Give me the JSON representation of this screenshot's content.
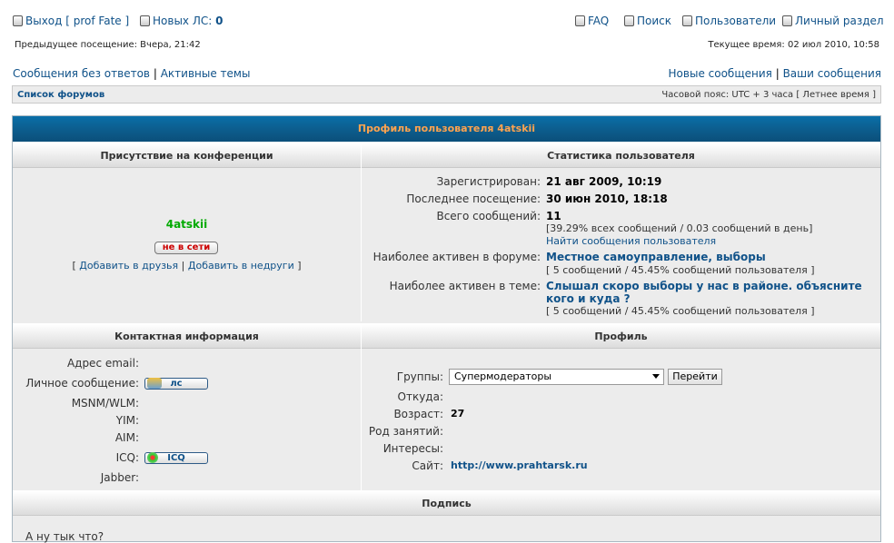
{
  "top": {
    "logout": "Выход [ prof Fate ]",
    "new_pm_label": "Новых ЛС:",
    "new_pm_count": "0",
    "faq": "FAQ",
    "search": "Поиск",
    "users": "Пользователи",
    "ucp": "Личный раздел",
    "last_visit": "Предыдущее посещение: Вчера, 21:42",
    "current_time": "Текущее время: 02 июл 2010, 10:58",
    "unanswered": "Сообщения без ответов",
    "active_topics": "Активные темы",
    "new_posts": "Новые сообщения",
    "your_posts": "Ваши сообщения",
    "sep": "|"
  },
  "navbar": {
    "forum_index": "Список форумов",
    "timezone": "Часовой пояс: UTC + 3 часа [ Летнее время ]"
  },
  "profile": {
    "title": "Профиль пользователя 4atskii",
    "h_presence": "Присутствие на конференции",
    "h_stats": "Статистика пользователя",
    "username": "4atskii",
    "status": "не в сети",
    "friend_open": "[",
    "add_friend": "Добавить в друзья",
    "add_foe": "Добавить в недруги",
    "friend_close": "]",
    "stats": {
      "registered_label": "Зарегистрирован:",
      "registered": "21 авг 2009, 10:19",
      "last_visit_label": "Последнее посещение:",
      "last_visit": "30 июн 2010, 18:18",
      "posts_label": "Всего сообщений:",
      "posts": "11",
      "posts_detail": "[39.29% всех сообщений / 0.03 сообщений в день]",
      "find_posts": "Найти сообщения пользователя",
      "active_forum_label": "Наиболее активен в форуме:",
      "active_forum": "Местное самоуправление, выборы",
      "active_forum_detail": "[ 5 сообщений / 45.45% сообщений пользователя ]",
      "active_topic_label": "Наиболее активен в теме:",
      "active_topic_line1": "Слышал скоро выборы у нас в районе. объясните",
      "active_topic_line2": "кого и куда ?",
      "active_topic_detail": "[ 5 сообщений / 45.45% сообщений пользователя ]"
    },
    "h_contact": "Контактная информация",
    "h_profile": "Профиль",
    "contact": {
      "email_label": "Адрес email:",
      "pm_label": "Личное сообщение:",
      "pm_button": "лс",
      "msnm_label": "MSNM/WLM:",
      "yim_label": "YIM:",
      "aim_label": "AIM:",
      "icq_label": "ICQ:",
      "icq_button": "ICQ",
      "jabber_label": "Jabber:"
    },
    "info": {
      "groups_label": "Группы:",
      "groups_selected": "Супермодераторы",
      "go_button": "Перейти",
      "from_label": "Откуда:",
      "age_label": "Возраст:",
      "age": "27",
      "occupation_label": "Род занятий:",
      "interests_label": "Интересы:",
      "site_label": "Сайт:",
      "site": "http://www.prahtarsk.ru"
    },
    "h_signature": "Подпись",
    "signature_partial": "А ну тык что?"
  },
  "colors": {
    "link": "#105289",
    "caption_text": "#ffa34f",
    "username": "#00aa00",
    "offline": "#cc0000"
  }
}
